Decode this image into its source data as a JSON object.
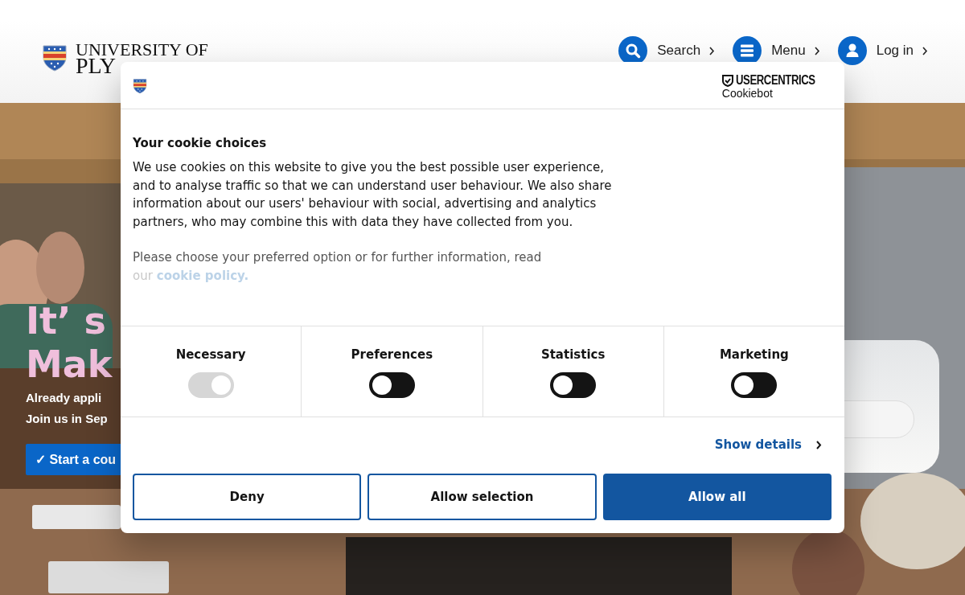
{
  "header": {
    "logo": {
      "line_1": "UNIVERSITY OF",
      "line_2": "PLY"
    },
    "nav": [
      {
        "kind": "search",
        "label": "Search"
      },
      {
        "kind": "menu",
        "label": "Menu"
      },
      {
        "kind": "user",
        "label": "Log in"
      }
    ]
  },
  "hero": {
    "headline": [
      "It’ s",
      "Mak"
    ],
    "lines": [
      "Already appli",
      "Join us in Sep"
    ],
    "button": "✓ Start a cou",
    "panel": {
      "kind": "picture"
    }
  },
  "cookie_dialog": {
    "brand": {
      "name": "USERCENTRICS",
      "product": "Cookiebot"
    },
    "title": "Your cookie choices",
    "body": "We use cookies on this website to give you the best possible user experience, and to analyse traffic so that we can understand user behaviour. We also share information about our users' behaviour with social, advertising and analytics partners, who may combine this with data they have collected from you.",
    "choose_text": "Please choose your preferred option or for further information, read",
    "faded_prefix": "our",
    "policy_link": "cookie policy.",
    "categories": [
      {
        "label": "Necessary",
        "checked": true,
        "disabled": true
      },
      {
        "label": "Preferences",
        "checked": false,
        "disabled": false
      },
      {
        "label": "Statistics",
        "checked": false,
        "disabled": false
      },
      {
        "label": "Marketing",
        "checked": false,
        "disabled": false
      }
    ],
    "show_details": "Show details",
    "buttons": [
      {
        "label": "Deny",
        "kind": "outline"
      },
      {
        "label": "Allow selection",
        "kind": "outline"
      },
      {
        "label": "Allow all",
        "kind": "primary"
      }
    ]
  }
}
